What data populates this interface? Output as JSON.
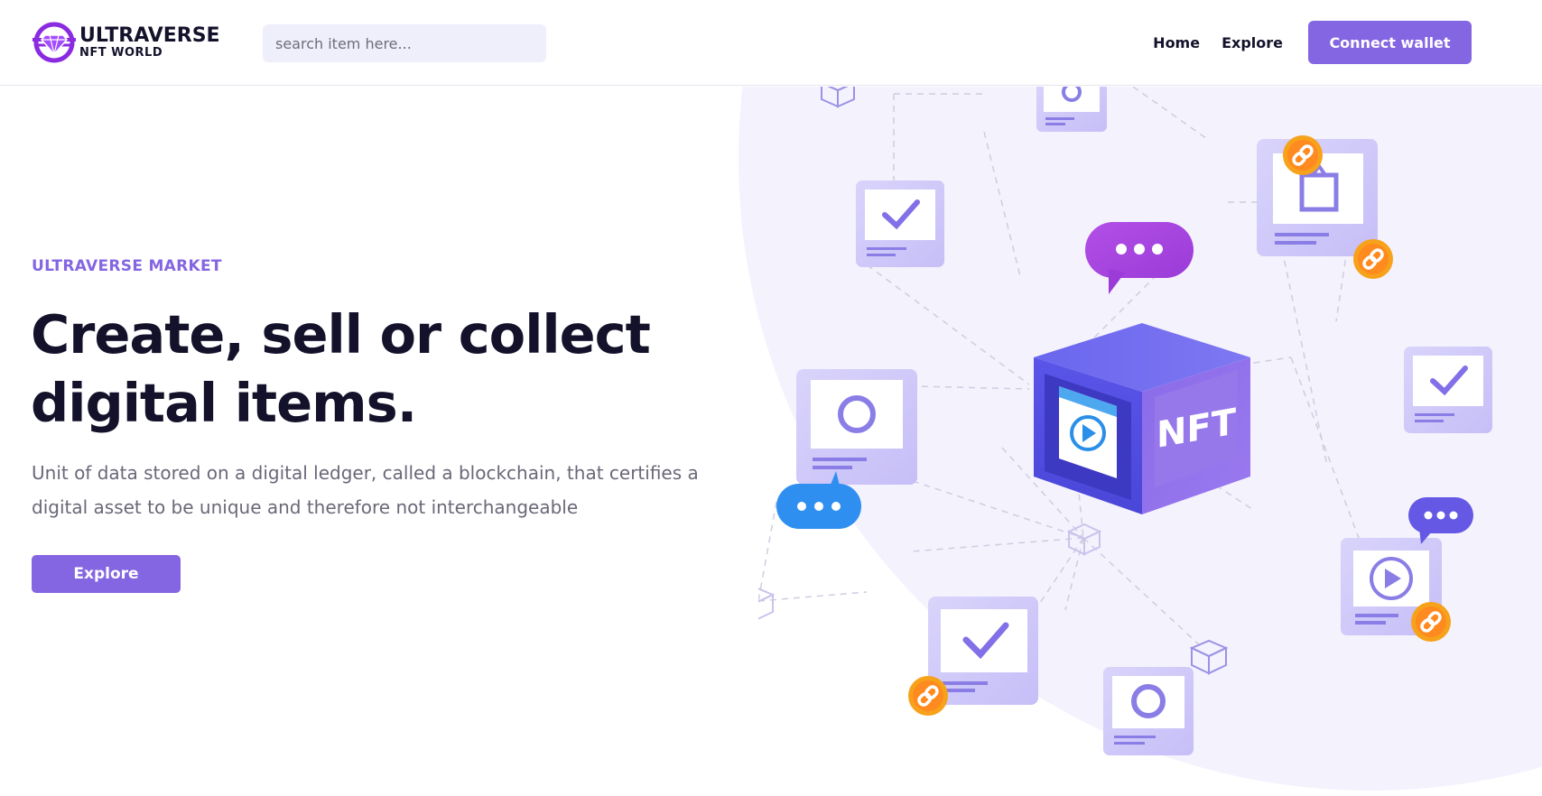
{
  "header": {
    "logo_title": "ULTRAVERSE",
    "logo_subtitle": "NFT WORLD",
    "search_placeholder": "search item here...",
    "nav": [
      {
        "label": "Home"
      },
      {
        "label": "Explore"
      }
    ],
    "connect_label": "Connect wallet"
  },
  "hero": {
    "eyebrow": "ULTRAVERSE MARKET",
    "headline": "Create, sell or collect digital items.",
    "description": "Unit of data stored on a digital ledger, called a blockchain, that certifies a digital asset to be unique and therefore not interchangeable",
    "cta_label": "Explore"
  },
  "illustration": {
    "cube_label": "NFT",
    "icons": [
      "cube-icon",
      "image-card-icon",
      "check-card-icon",
      "play-card-icon",
      "chat-bubble-icon",
      "chain-link-icon"
    ]
  },
  "colors": {
    "accent": "#8466e2",
    "arc_background": "#f4f2fd",
    "text_dark": "#14122b",
    "text_muted": "#6a6878"
  }
}
